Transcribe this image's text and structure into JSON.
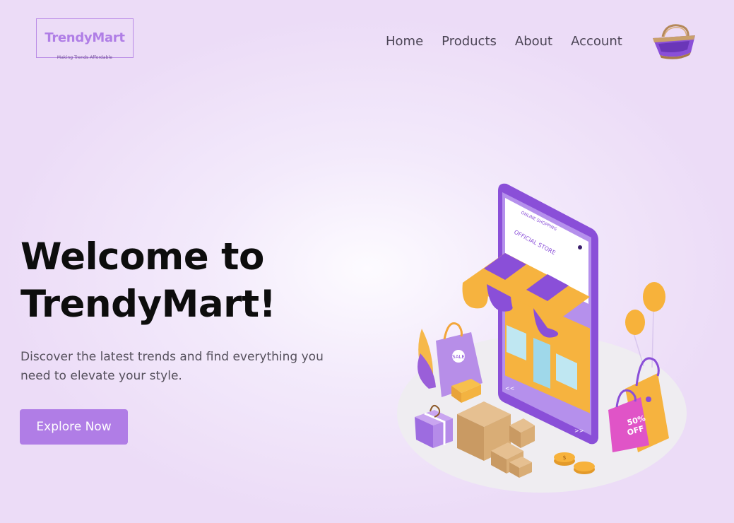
{
  "brand": {
    "name": "TrendyMart",
    "tagline": "Making Trends Affordable"
  },
  "nav": {
    "items": [
      {
        "label": "Home"
      },
      {
        "label": "Products"
      },
      {
        "label": "About"
      },
      {
        "label": "Account"
      }
    ],
    "cart_icon": "shopping-basket-icon"
  },
  "hero": {
    "title_line1": "Welcome to",
    "title_line2": "TrendyMart!",
    "subtitle": "Discover the latest trends and find everything you need to elevate your style.",
    "cta_label": "Explore Now"
  },
  "illustration": {
    "screen_header": "ONLINE SHOPPING",
    "store_sign": "OFFICIAL STORE",
    "bag_tag": "SALE",
    "discount_line1": "50%",
    "discount_line2": "OFF",
    "coin_symbol": "$",
    "nav_prev": "<<",
    "nav_next": ">>"
  },
  "colors": {
    "accent": "#b07de6",
    "brand_purple": "#8a4fd8",
    "awning_orange": "#f7b23b",
    "text_dark": "#0d0d0d",
    "text_muted": "#55505c"
  }
}
